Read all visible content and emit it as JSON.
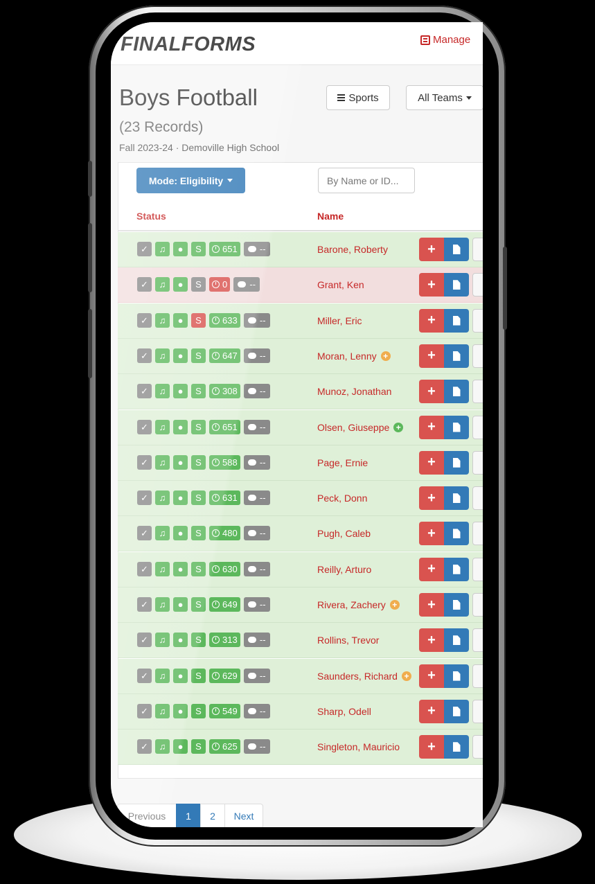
{
  "header": {
    "logo": "FINALFORMS",
    "manage_label": "Manage"
  },
  "page": {
    "title": "Boys Football",
    "records": "(23 Records)",
    "subtitle": "Fall 2023-24 · Demoville High School"
  },
  "toolbar": {
    "sports_label": "Sports",
    "teams_label": "All Teams",
    "mode_label": "Mode: Eligibility",
    "search_placeholder": "By Name or ID..."
  },
  "table": {
    "headers": {
      "status": "Status",
      "name": "Name"
    },
    "rows": [
      {
        "name": "Barone, Roberty",
        "score": "651",
        "state": "ok",
        "dollar": "ok",
        "flag": ""
      },
      {
        "name": "Grant, Ken",
        "score": "0",
        "state": "bad",
        "dollar": "gray",
        "flag": ""
      },
      {
        "name": "Miller, Eric",
        "score": "633",
        "state": "ok",
        "dollar": "bad",
        "flag": ""
      },
      {
        "name": "Moran, Lenny",
        "score": "647",
        "state": "ok",
        "dollar": "ok",
        "flag": "orange"
      },
      {
        "name": "Munoz, Jonathan",
        "score": "308",
        "state": "ok",
        "dollar": "ok",
        "flag": ""
      },
      {
        "name": "Olsen, Giuseppe",
        "score": "651",
        "state": "ok",
        "dollar": "ok",
        "flag": "green"
      },
      {
        "name": "Page, Ernie",
        "score": "588",
        "state": "ok",
        "dollar": "ok",
        "flag": ""
      },
      {
        "name": "Peck, Donn",
        "score": "631",
        "state": "ok",
        "dollar": "ok",
        "flag": ""
      },
      {
        "name": "Pugh, Caleb",
        "score": "480",
        "state": "ok",
        "dollar": "ok",
        "flag": ""
      },
      {
        "name": "Reilly, Arturo",
        "score": "630",
        "state": "ok",
        "dollar": "ok",
        "flag": ""
      },
      {
        "name": "Rivera, Zachery",
        "score": "649",
        "state": "ok",
        "dollar": "ok",
        "flag": "orange"
      },
      {
        "name": "Rollins, Trevor",
        "score": "313",
        "state": "ok",
        "dollar": "ok",
        "flag": ""
      },
      {
        "name": "Saunders, Richard",
        "score": "629",
        "state": "ok",
        "dollar": "ok",
        "flag": "orange"
      },
      {
        "name": "Sharp, Odell",
        "score": "549",
        "state": "ok",
        "dollar": "ok",
        "flag": ""
      },
      {
        "name": "Singleton, Mauricio",
        "score": "625",
        "state": "ok",
        "dollar": "ok",
        "flag": ""
      }
    ],
    "badge_text": {
      "dollar": "S",
      "comment": "--",
      "add": "+"
    }
  },
  "pagination": {
    "prev": "Previous",
    "pages": [
      "1",
      "2"
    ],
    "active": "1",
    "next": "Next"
  },
  "icons": {
    "check": "check-square-icon",
    "music": "music-note-icon",
    "person": "person-icon",
    "clock": "clock-icon",
    "comment": "comment-icon",
    "document": "document-icon"
  },
  "colors": {
    "brand_red": "#c62828",
    "primary_blue": "#337ab7",
    "success": "#5cb85c",
    "danger": "#d9534f",
    "row_ok": "#dff0d8",
    "row_bad": "#f2dede"
  }
}
